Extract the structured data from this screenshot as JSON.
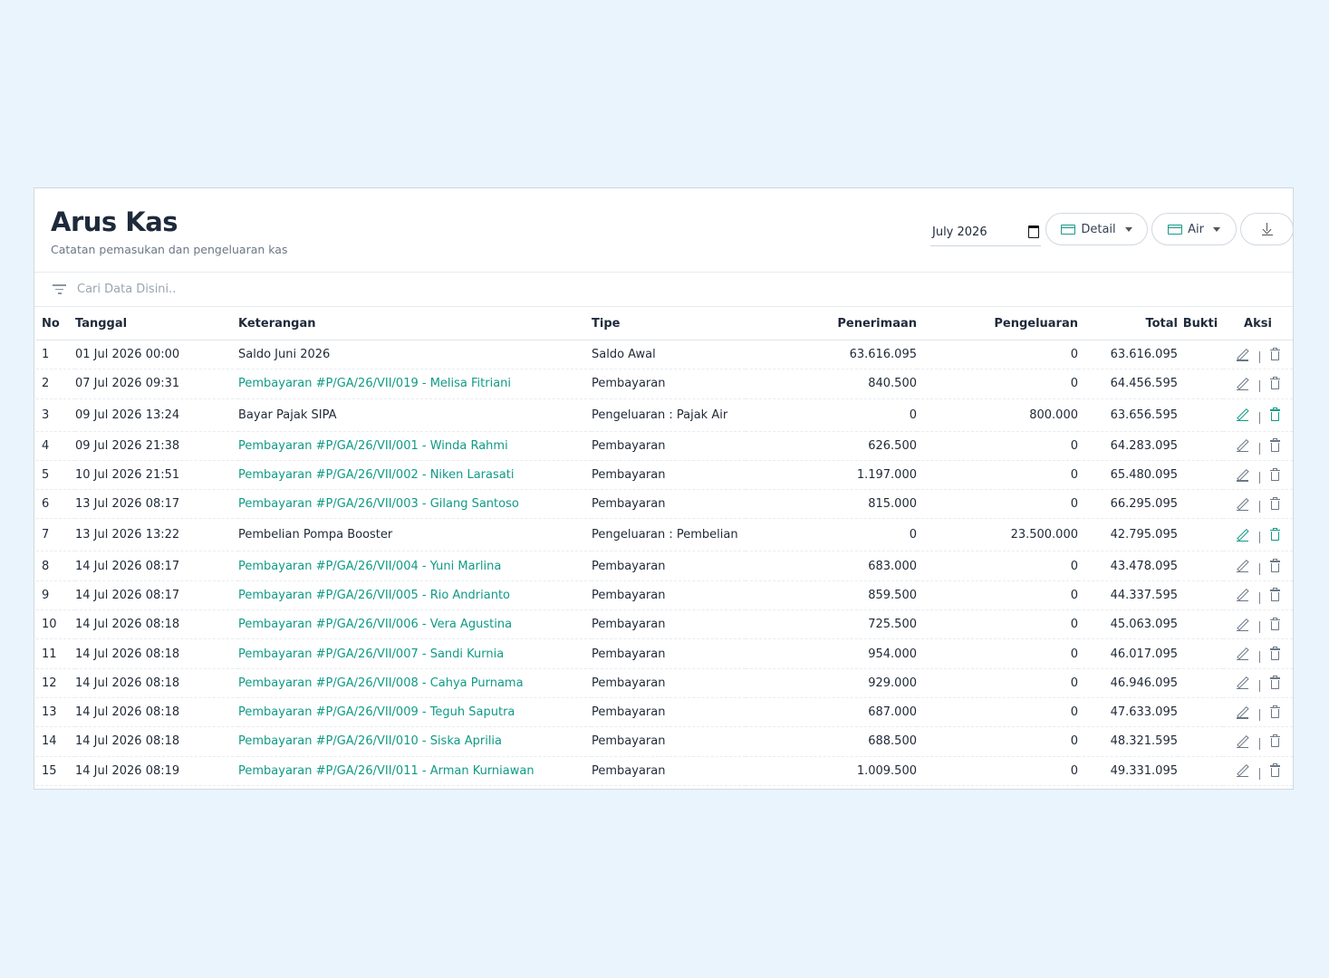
{
  "header": {
    "title": "Arus Kas",
    "subtitle": "Catatan pemasukan dan pengeluaran kas",
    "month_value": "July  2026",
    "detail_label": "Detail",
    "air_label": "Air"
  },
  "search": {
    "placeholder": "Cari Data Disini.."
  },
  "table": {
    "columns": [
      "No",
      "Tanggal",
      "Keterangan",
      "Tipe",
      "Penerimaan",
      "Pengeluaran",
      "Total",
      "Bukti",
      "Aksi"
    ],
    "rows": [
      {
        "no": "1",
        "tanggal": "01 Jul 2026 00:00",
        "keterangan": "Saldo Juni 2026",
        "link": false,
        "tipe": "Saldo Awal",
        "penerimaan": "63.616.095",
        "pengeluaran": "0",
        "total": "63.616.095",
        "highlight": false
      },
      {
        "no": "2",
        "tanggal": "07 Jul 2026 09:31",
        "keterangan": "Pembayaran #P/GA/26/VII/019 - Melisa Fitriani",
        "link": true,
        "tipe": "Pembayaran",
        "penerimaan": "840.500",
        "pengeluaran": "0",
        "total": "64.456.595",
        "highlight": false
      },
      {
        "no": "3",
        "tanggal": "09 Jul 2026 13:24",
        "keterangan": "Bayar Pajak SIPA",
        "link": false,
        "tipe": "Pengeluaran : Pajak Air",
        "penerimaan": "0",
        "pengeluaran": "800.000",
        "total": "63.656.595",
        "highlight": true
      },
      {
        "no": "4",
        "tanggal": "09 Jul 2026 21:38",
        "keterangan": "Pembayaran #P/GA/26/VII/001 - Winda Rahmi",
        "link": true,
        "tipe": "Pembayaran",
        "penerimaan": "626.500",
        "pengeluaran": "0",
        "total": "64.283.095",
        "highlight": false
      },
      {
        "no": "5",
        "tanggal": "10 Jul 2026 21:51",
        "keterangan": "Pembayaran #P/GA/26/VII/002 - Niken Larasati",
        "link": true,
        "tipe": "Pembayaran",
        "penerimaan": "1.197.000",
        "pengeluaran": "0",
        "total": "65.480.095",
        "highlight": false
      },
      {
        "no": "6",
        "tanggal": "13 Jul 2026 08:17",
        "keterangan": "Pembayaran #P/GA/26/VII/003 - Gilang Santoso",
        "link": true,
        "tipe": "Pembayaran",
        "penerimaan": "815.000",
        "pengeluaran": "0",
        "total": "66.295.095",
        "highlight": false
      },
      {
        "no": "7",
        "tanggal": "13 Jul 2026 13:22",
        "keterangan": "Pembelian Pompa Booster",
        "link": false,
        "tipe": "Pengeluaran : Pembelian",
        "penerimaan": "0",
        "pengeluaran": "23.500.000",
        "total": "42.795.095",
        "highlight": true
      },
      {
        "no": "8",
        "tanggal": "14 Jul 2026 08:17",
        "keterangan": "Pembayaran #P/GA/26/VII/004 - Yuni Marlina",
        "link": true,
        "tipe": "Pembayaran",
        "penerimaan": "683.000",
        "pengeluaran": "0",
        "total": "43.478.095",
        "highlight": false
      },
      {
        "no": "9",
        "tanggal": "14 Jul 2026 08:17",
        "keterangan": "Pembayaran #P/GA/26/VII/005 - Rio Andrianto",
        "link": true,
        "tipe": "Pembayaran",
        "penerimaan": "859.500",
        "pengeluaran": "0",
        "total": "44.337.595",
        "highlight": false
      },
      {
        "no": "10",
        "tanggal": "14 Jul 2026 08:18",
        "keterangan": "Pembayaran #P/GA/26/VII/006 - Vera Agustina",
        "link": true,
        "tipe": "Pembayaran",
        "penerimaan": "725.500",
        "pengeluaran": "0",
        "total": "45.063.095",
        "highlight": false
      },
      {
        "no": "11",
        "tanggal": "14 Jul 2026 08:18",
        "keterangan": "Pembayaran #P/GA/26/VII/007 - Sandi Kurnia",
        "link": true,
        "tipe": "Pembayaran",
        "penerimaan": "954.000",
        "pengeluaran": "0",
        "total": "46.017.095",
        "highlight": false
      },
      {
        "no": "12",
        "tanggal": "14 Jul 2026 08:18",
        "keterangan": "Pembayaran #P/GA/26/VII/008 - Cahya Purnama",
        "link": true,
        "tipe": "Pembayaran",
        "penerimaan": "929.000",
        "pengeluaran": "0",
        "total": "46.946.095",
        "highlight": false
      },
      {
        "no": "13",
        "tanggal": "14 Jul 2026 08:18",
        "keterangan": "Pembayaran #P/GA/26/VII/009 - Teguh Saputra",
        "link": true,
        "tipe": "Pembayaran",
        "penerimaan": "687.000",
        "pengeluaran": "0",
        "total": "47.633.095",
        "highlight": false
      },
      {
        "no": "14",
        "tanggal": "14 Jul 2026 08:18",
        "keterangan": "Pembayaran #P/GA/26/VII/010 - Siska Aprilia",
        "link": true,
        "tipe": "Pembayaran",
        "penerimaan": "688.500",
        "pengeluaran": "0",
        "total": "48.321.595",
        "highlight": false
      },
      {
        "no": "15",
        "tanggal": "14 Jul 2026 08:19",
        "keterangan": "Pembayaran #P/GA/26/VII/011 - Arman Kurniawan",
        "link": true,
        "tipe": "Pembayaran",
        "penerimaan": "1.009.500",
        "pengeluaran": "0",
        "total": "49.331.095",
        "highlight": false
      }
    ]
  },
  "colors": {
    "accent": "#0f9a86",
    "background": "#eaf4fd",
    "title": "#1e2a3b"
  },
  "icons": [
    "calendar-icon",
    "card-icon",
    "chevron-down-icon",
    "download-icon",
    "filter-icon",
    "pencil-icon",
    "trash-icon"
  ]
}
